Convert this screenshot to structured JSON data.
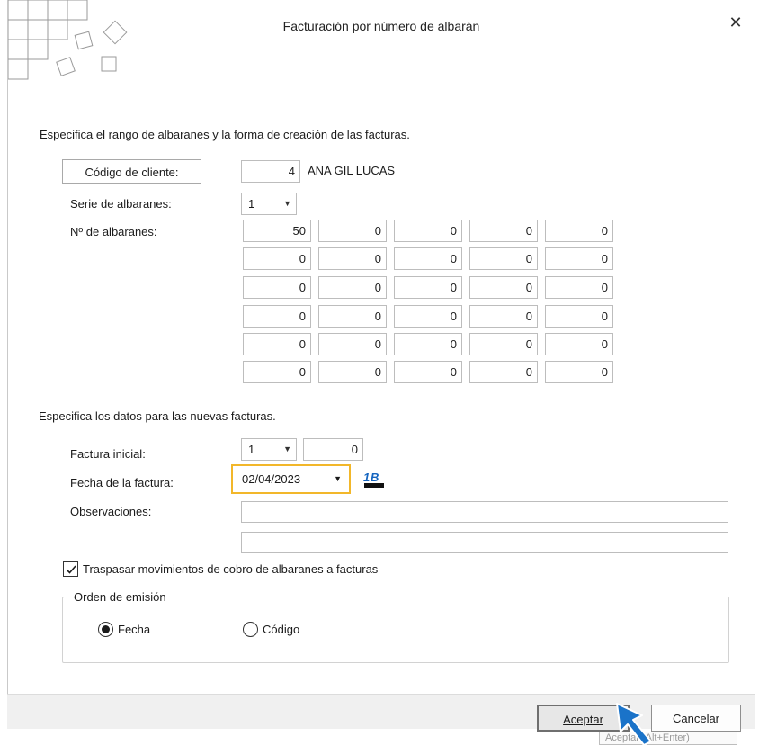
{
  "window": {
    "title": "Facturación por número de albarán",
    "close_glyph": "✕"
  },
  "section1": {
    "heading": "Especifica el rango de albaranes y la forma de creación de las facturas."
  },
  "client": {
    "button_label": "Código de cliente:",
    "code": "4",
    "name": "ANA GIL LUCAS"
  },
  "serie": {
    "label": "Serie de albaranes:",
    "value": "1"
  },
  "albaranes": {
    "label": "Nº de albaranes:",
    "rows": [
      [
        "50",
        "0",
        "0",
        "0",
        "0"
      ],
      [
        "0",
        "0",
        "0",
        "0",
        "0"
      ],
      [
        "0",
        "0",
        "0",
        "0",
        "0"
      ],
      [
        "0",
        "0",
        "0",
        "0",
        "0"
      ],
      [
        "0",
        "0",
        "0",
        "0",
        "0"
      ],
      [
        "0",
        "0",
        "0",
        "0",
        "0"
      ]
    ]
  },
  "section2": {
    "heading": "Especifica los datos para las nuevas facturas."
  },
  "factura_inicial": {
    "label": "Factura inicial:",
    "serie": "1",
    "numero": "0"
  },
  "fecha": {
    "label": "Fecha de la factura:",
    "value": "02/04/2023",
    "icon": "calendar-icon",
    "highlight_color": "#f2b72a"
  },
  "observaciones": {
    "label": "Observaciones:",
    "line1": "",
    "line2": ""
  },
  "traspasar": {
    "label": "Traspasar movimientos de cobro de albaranes a facturas",
    "checked": true
  },
  "orden": {
    "legend": "Orden de emisión",
    "options": [
      "Fecha",
      "Código"
    ],
    "selected": "Fecha"
  },
  "buttons": {
    "accept": "Aceptar",
    "cancel": "Cancelar"
  },
  "tooltip": {
    "text": "Aceptar (Alt+Enter)"
  },
  "colors": {
    "accent_cursor": "#1a73c9"
  }
}
